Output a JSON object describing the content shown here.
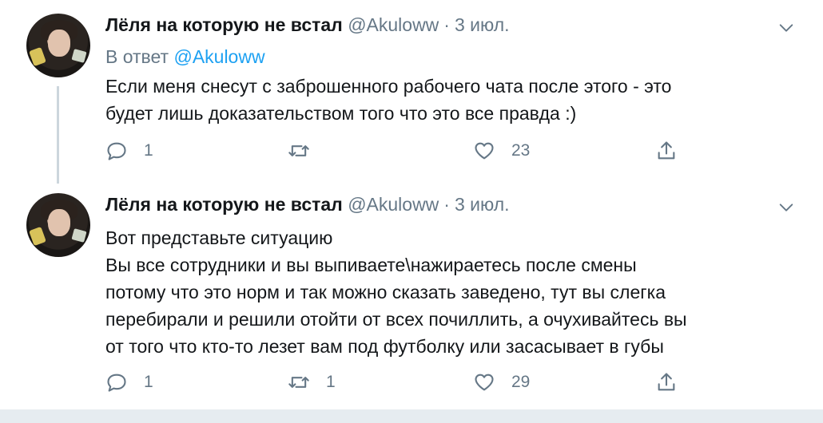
{
  "tweets": [
    {
      "display_name": "Лёля на которую не встал",
      "handle": "@Akuloww",
      "separator": "·",
      "date": "3 июл.",
      "reply_prefix": "В ответ",
      "reply_mention": "@Akuloww",
      "text_lines": [
        "Если меня снесут с заброшенного рабочего чата после этого - это",
        "будет лишь доказательством того что это все правда :)"
      ],
      "reply_count": "1",
      "retweet_count": "",
      "like_count": "23"
    },
    {
      "display_name": "Лёля на которую не встал",
      "handle": "@Akuloww",
      "separator": "·",
      "date": "3 июл.",
      "text_lines": [
        "Вот представьте ситуацию",
        "Вы все сотрудники и вы выпиваете\\нажираетесь после смены",
        "потому что это норм и так можно сказать заведено, тут вы слегка",
        "перебирали и решили отойти от всех почиллить, а очухивайтесь вы",
        "от того что кто-то лезет вам под футболку или засасывает в губы"
      ],
      "reply_count": "1",
      "retweet_count": "1",
      "like_count": "29"
    }
  ],
  "icons": {
    "reply": "reply-icon",
    "retweet": "retweet-icon",
    "like": "like-icon",
    "share": "share-icon",
    "more": "chevron-down-icon"
  },
  "colors": {
    "link": "#1da1f2",
    "muted": "#657786",
    "thread_line": "#ccd6dd"
  }
}
